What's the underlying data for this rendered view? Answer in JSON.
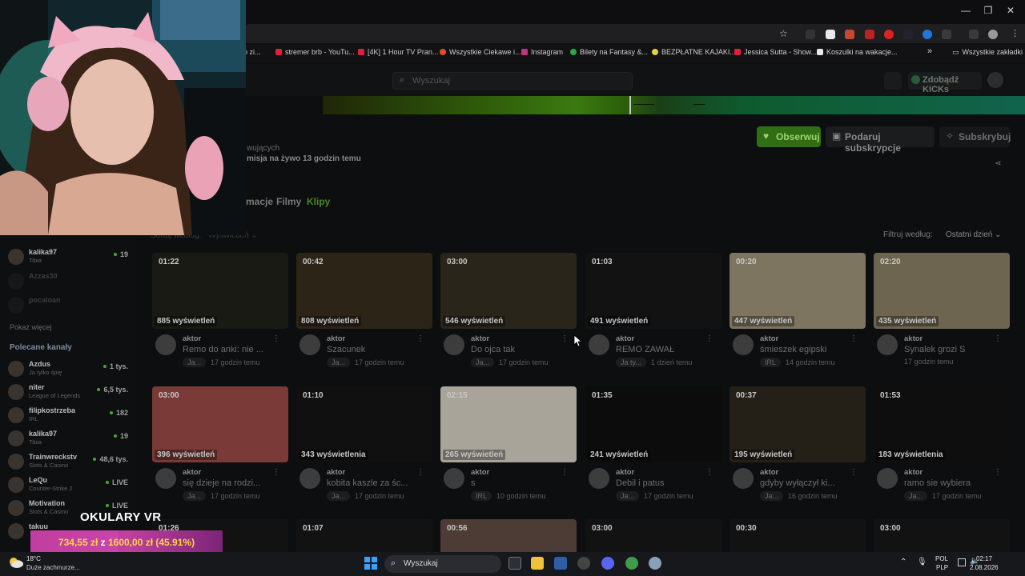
{
  "window_controls": [
    "—",
    "❐",
    "✕"
  ],
  "bookmarks": [
    {
      "label": "ło zi...",
      "color": "#d33"
    },
    {
      "label": "stremer brb - YouTu...",
      "color": "#e0203a"
    },
    {
      "label": "[4K] 1 Hour TV Pran...",
      "color": "#e0203a"
    },
    {
      "label": "Wszystkie Ciekawe i...",
      "color": "#e05020"
    },
    {
      "label": "Instagram",
      "color": "#c13584"
    },
    {
      "label": "Bilety na Fantasy &...",
      "color": "#2aa84a"
    },
    {
      "label": "BEZPŁATNE KAJAKI...",
      "color": "#e6d43a"
    },
    {
      "label": "Jessica Sutta - Show...",
      "color": "#e0203a"
    },
    {
      "label": "Koszulki na wakacje...",
      "color": "#e8e8e8"
    },
    {
      "label": "»",
      "color": ""
    },
    {
      "label": "Wszystkie zakładki",
      "color": ""
    }
  ],
  "kick": {
    "search_placeholder": "Wyszukaj",
    "get_kicks": "Zdobądź KICKs",
    "follow": "Obserwuj",
    "gift": "Podaruj subskrypcje",
    "subscribe": "Subskrybuj",
    "followers": "wujących",
    "last_live": "misja na żywo 13 godzin temu",
    "tabs": [
      "macje",
      "Filmy",
      "Klipy"
    ],
    "sort_label": "Sortuj według:",
    "sort_value": "Wyświetleń",
    "filter_label": "Filtruj według:",
    "filter_value": "Ostatni dzień"
  },
  "sidebar": {
    "top_items": [
      {
        "name": "kalika97",
        "category": "Tibia",
        "count": "19"
      },
      {
        "name": "Azzas30",
        "category": "",
        "count": ""
      },
      {
        "name": "pocaloan",
        "category": "",
        "count": ""
      }
    ],
    "show_more": "Pokaż więcej",
    "recommended_title": "Polecane kanały",
    "recommended": [
      {
        "name": "Azdus",
        "category": "Ja tylko śpię",
        "count": "1 tys."
      },
      {
        "name": "niter",
        "category": "League of Legends",
        "count": "6,5 tys."
      },
      {
        "name": "filipkostrzeba",
        "category": "IRL",
        "count": "182"
      },
      {
        "name": "kalika97",
        "category": "Tibia",
        "count": "19"
      },
      {
        "name": "Trainwreckstv",
        "category": "Slots & Casino",
        "count": "48,6 tys."
      },
      {
        "name": "LeQu",
        "category": "Counter-Strike 2",
        "count": "LIVE"
      },
      {
        "name": "Motivation",
        "category": "Slots & Casino",
        "count": "LIVE"
      },
      {
        "name": "takuu",
        "category": "",
        "count": ""
      }
    ]
  },
  "clips": [
    {
      "duration": "01:22",
      "views": "885 wyświetleń",
      "author": "aktor",
      "title": "Remo do anki: nie ...",
      "tag": "Ja...",
      "age": "17 godzin temu",
      "bg": "#1a1a14"
    },
    {
      "duration": "00:42",
      "views": "808 wyświetleń",
      "author": "aktor",
      "title": "Szacunek",
      "tag": "Ja...",
      "age": "17 godzin temu",
      "bg": "#2b2417"
    },
    {
      "duration": "03:00",
      "views": "546 wyświetleń",
      "author": "aktor",
      "title": "Do ojca tak",
      "tag": "Ja...",
      "age": "17 godzin temu",
      "bg": "#29251a"
    },
    {
      "duration": "01:03",
      "views": "491 wyświetleń",
      "author": "aktor",
      "title": "REMO ZAWAŁ",
      "tag": "Ja ty...",
      "age": "1 dzień temu",
      "bg": "#121212"
    },
    {
      "duration": "00:20",
      "views": "447 wyświetleń",
      "author": "aktor",
      "title": "śmieszek egipski",
      "tag": "IRL",
      "age": "14 godzin temu",
      "bg": "#7d7560"
    },
    {
      "duration": "02:20",
      "views": "435 wyświetleń",
      "author": "aktor",
      "title": "Synalek grozi S",
      "tag": "",
      "age": "17 godzin temu",
      "bg": "#6e6550"
    },
    {
      "duration": "03:00",
      "views": "396 wyświetleń",
      "author": "aktor",
      "title": "się dzieje na rodzi...",
      "tag": "Ja...",
      "age": "17 godzin temu",
      "bg": "#7a3a38"
    },
    {
      "duration": "01:10",
      "views": "343 wyświetlenia",
      "author": "aktor",
      "title": "kobita kaszle za śc...",
      "tag": "Ja...",
      "age": "17 godzin temu",
      "bg": "#101011"
    },
    {
      "duration": "02:15",
      "views": "265 wyświetleń",
      "author": "aktor",
      "title": "s",
      "tag": "IRL",
      "age": "10 godzin temu",
      "bg": "#a9a49a"
    },
    {
      "duration": "01:35",
      "views": "241 wyświetleń",
      "author": "aktor",
      "title": "Debil i patus",
      "tag": "Ja...",
      "age": "17 godzin temu",
      "bg": "#0c0c0c"
    },
    {
      "duration": "00:37",
      "views": "195 wyświetleń",
      "author": "aktor",
      "title": "gdyby wyłączył ki...",
      "tag": "Ja...",
      "age": "16 godzin temu",
      "bg": "#242017"
    },
    {
      "duration": "01:53",
      "views": "183 wyświetlenia",
      "author": "aktor",
      "title": "ramo sie wybiera",
      "tag": "Ja...",
      "age": "17 godzin temu",
      "bg": "#0e0e0e"
    },
    {
      "duration": "01:26",
      "views": "",
      "author": "",
      "title": "",
      "tag": "",
      "age": "",
      "bg": "#121212"
    },
    {
      "duration": "01:07",
      "views": "",
      "author": "",
      "title": "",
      "tag": "",
      "age": "",
      "bg": "#121212"
    },
    {
      "duration": "00:56",
      "views": "",
      "author": "",
      "title": "",
      "tag": "",
      "age": "",
      "bg": "#4d3b35"
    },
    {
      "duration": "03:00",
      "views": "",
      "author": "",
      "title": "",
      "tag": "",
      "age": "",
      "bg": "#121212"
    },
    {
      "duration": "00:30",
      "views": "",
      "author": "",
      "title": "",
      "tag": "",
      "age": "",
      "bg": "#121212"
    },
    {
      "duration": "03:00",
      "views": "",
      "author": "",
      "title": "",
      "tag": "",
      "age": "",
      "bg": "#121212"
    }
  ],
  "goal": {
    "title": "OKULARY VR",
    "current": "734,55 zł",
    "separator": "z",
    "target": "1600,00 zł",
    "percent": "(45.91%)",
    "progress_fraction": 0.4591
  },
  "taskbar": {
    "temp": "18°C",
    "weather": "Duże zachmurze...",
    "search": "Wyszukaj",
    "lang1": "POL",
    "lang2": "PLP",
    "time": "02:17",
    "date": "2.08.2026"
  },
  "colors": {
    "accent": "#53fc18",
    "goal": "#b8389a"
  }
}
